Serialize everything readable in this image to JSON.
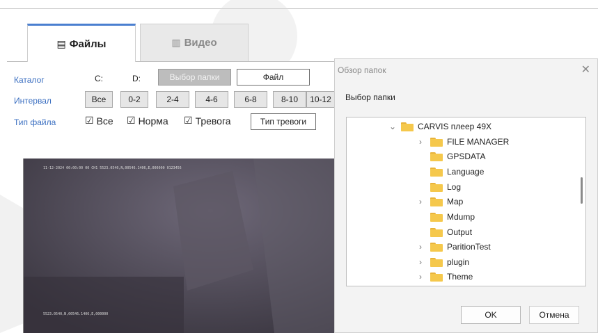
{
  "tabs": [
    {
      "label": "Файлы",
      "icon": "file-list-icon",
      "active": true
    },
    {
      "label": "Видео",
      "icon": "film-icon",
      "active": false
    }
  ],
  "panel": {
    "catalog": {
      "label": "Каталог",
      "drive_c": "C:",
      "drive_d": "D:",
      "select_folder": "Выбор папки",
      "file": "Файл"
    },
    "interval": {
      "label": "Интервал",
      "buttons": [
        "Все",
        "0-2",
        "2-4",
        "4-6",
        "6-8",
        "8-10",
        "10-12"
      ]
    },
    "file_type": {
      "label": "Тип файла",
      "all": "Все",
      "normal": "Норма",
      "alarm": "Тревога",
      "alarm_type": "Тип тревоги"
    }
  },
  "dialog": {
    "title": "Обзор папок",
    "subtitle": "Выбор папки",
    "tree": [
      {
        "name": "CARVIS плеер 49X",
        "level": 0,
        "expander": "expanded"
      },
      {
        "name": "FILE MANAGER",
        "level": 1,
        "expander": "collapsed"
      },
      {
        "name": "GPSDATA",
        "level": 1,
        "expander": "none"
      },
      {
        "name": "Language",
        "level": 1,
        "expander": "none"
      },
      {
        "name": "Log",
        "level": 1,
        "expander": "none"
      },
      {
        "name": "Map",
        "level": 1,
        "expander": "collapsed"
      },
      {
        "name": "Mdump",
        "level": 1,
        "expander": "none"
      },
      {
        "name": "Output",
        "level": 1,
        "expander": "none"
      },
      {
        "name": "ParitionTest",
        "level": 1,
        "expander": "collapsed"
      },
      {
        "name": "plugin",
        "level": 1,
        "expander": "collapsed"
      },
      {
        "name": "Theme",
        "level": 1,
        "expander": "collapsed"
      }
    ],
    "ok": "OK",
    "cancel": "Отмена"
  },
  "video": {
    "overlay_top": "11-12-2024 00:00:00 00  CH1 5523.0540,N,00546.1406,E,000000 0123456",
    "overlay_bottom": "5523.0540,N,00546.1406,E,000000"
  },
  "colors": {
    "accent": "#4a7fd0",
    "label_blue": "#3b6fc1",
    "folder": "#f5c84c"
  }
}
